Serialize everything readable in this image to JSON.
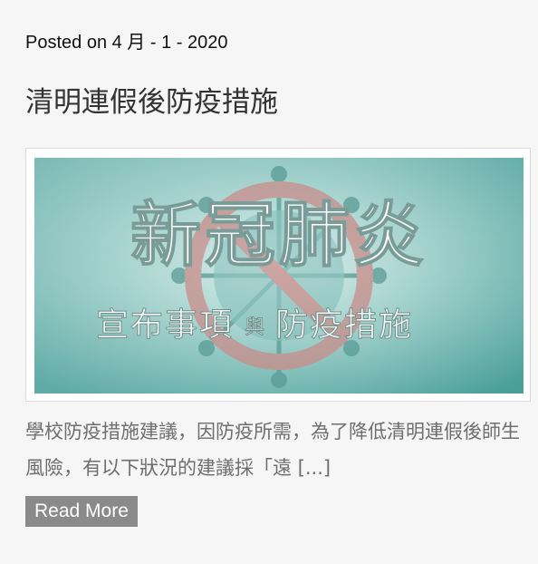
{
  "post": {
    "meta": "Posted on 4 月 - 1 - 2020",
    "title": "清明連假後防疫措施",
    "image": {
      "headline": "新冠肺炎",
      "subheadline_left": "宣布事項",
      "subheadline_connector": "與",
      "subheadline_right": "防疫措施",
      "icon": "virus-prohibited-icon"
    },
    "excerpt": "學校防疫措施建議，因防疫所需，為了降低清明連假後師生風險，有以下狀況的建議採「遠 [...]",
    "read_more_label": "Read More"
  },
  "colors": {
    "background": "#f6f6f6",
    "title": "#333333",
    "excerpt": "#6e6e6e",
    "button_bg": "#8a8a8a",
    "button_text": "#ffffff",
    "image_teal": "#5fb3ad",
    "image_ring": "#c98d8a"
  }
}
